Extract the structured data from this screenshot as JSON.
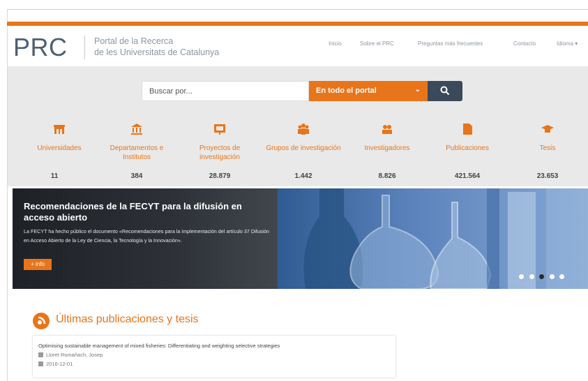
{
  "header": {
    "logo": "PRC",
    "tagline_line1": "Portal de la Recerca",
    "tagline_line2": "de les Universitats de Catalunya",
    "nav": [
      "Inicio",
      "Sobre el PRC",
      "Preguntas más frecuentes",
      "Contacto",
      "Idioma ▾"
    ]
  },
  "search": {
    "placeholder": "Buscar por...",
    "scope": "En todo el portal",
    "icon": "search-icon"
  },
  "categories": [
    {
      "label": "Universidades",
      "count": "11",
      "icon": "university-icon"
    },
    {
      "label": "Departamentos e Institutos",
      "count": "384",
      "icon": "department-icon"
    },
    {
      "label": "Proyectos de investigación",
      "count": "28.879",
      "icon": "project-icon"
    },
    {
      "label": "Grupos de investigación",
      "count": "1.442",
      "icon": "group-icon"
    },
    {
      "label": "Investigadores",
      "count": "8.826",
      "icon": "researchers-icon"
    },
    {
      "label": "Publicaciones",
      "count": "421.564",
      "icon": "document-icon"
    },
    {
      "label": "Tesis",
      "count": "23.653",
      "icon": "graduation-cap-icon"
    }
  ],
  "banner": {
    "title": "Recomendaciones de la FECYT para la difusión en acceso abierto",
    "text": "La FECYT ha hecho público el documento «Recomendaciones para la implementación del artículo 37 Difusión en Acceso Abierto de la Ley de Ciencia, la Tecnología y la Innovación».",
    "button": "+ info",
    "active_slide": 3,
    "slides": 5
  },
  "latest": {
    "title": "Últimas publicaciones y tesis",
    "items": [
      {
        "title": "Optimising sustainable management of mixed fisheries: Differentiating and weighting selective strategies",
        "author": "Lloret Romañach, Josep",
        "date": "2016-12-01"
      }
    ]
  },
  "colors": {
    "accent": "#e8751a",
    "dark": "#3a4a5a",
    "band": "#e9e9e9"
  }
}
